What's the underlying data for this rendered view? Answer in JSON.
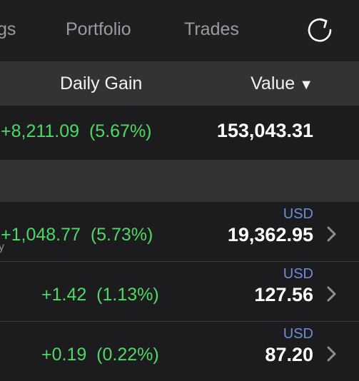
{
  "tabs": {
    "holdings": "gs",
    "portfolio": "Portfolio",
    "trades": "Trades"
  },
  "columns": {
    "daily_gain": "Daily Gain",
    "value": "Value",
    "sort_indicator": "▼"
  },
  "total": {
    "daily_gain": "+8,211.09",
    "daily_gain_pct": "(5.67%)",
    "value": "153,043.31"
  },
  "holdings": [
    {
      "currency": "USD",
      "daily_gain": "+1,048.77",
      "daily_gain_pct": "(5.73%)",
      "value": "19,362.95",
      "truncated_label": "y"
    },
    {
      "currency": "USD",
      "daily_gain": "+1.42",
      "daily_gain_pct": "(1.13%)",
      "value": "127.56"
    },
    {
      "currency": "USD",
      "daily_gain": "+0.19",
      "daily_gain_pct": "(0.22%)",
      "value": "87.20"
    }
  ],
  "icons": {
    "refresh": "refresh-icon",
    "row_chevron": "chevron-right-icon"
  },
  "colors": {
    "gain_green": "#4cd964",
    "currency_blue": "#6c8fd6",
    "background": "#1c1c1e",
    "header_gray": "#333336"
  }
}
